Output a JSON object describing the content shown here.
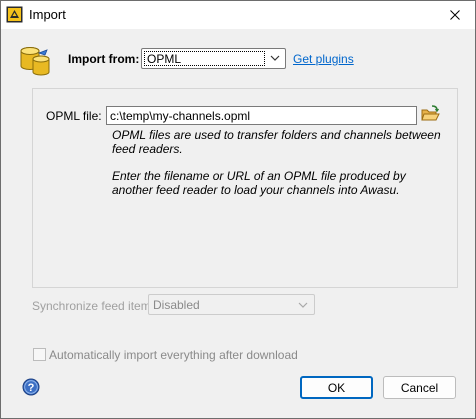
{
  "window": {
    "title": "Import",
    "close_glyph": "✕"
  },
  "import_from": {
    "label": "Import from:",
    "selected": "OPML",
    "plugins_link": "Get plugins"
  },
  "opml": {
    "label": "OPML file:",
    "value": "c:\\temp\\my-channels.opml",
    "description1": "OPML files are used to transfer folders and channels between feed readers.",
    "description2": "Enter the filename or URL of an OPML file produced by another feed reader to load your channels into Awasu."
  },
  "sync": {
    "label": "Synchronize feed items:",
    "selected": "Disabled"
  },
  "auto_import": {
    "label": "Automatically import everything after download",
    "checked": false
  },
  "buttons": {
    "ok": "OK",
    "cancel": "Cancel"
  },
  "icons": {
    "title": "awasu-app-icon",
    "header": "database-icon",
    "browse": "folder-open-icon",
    "help": "help-icon"
  },
  "colors": {
    "link": "#0066cc",
    "accent": "#0067c0",
    "disabled_text": "#8a8a8a"
  }
}
